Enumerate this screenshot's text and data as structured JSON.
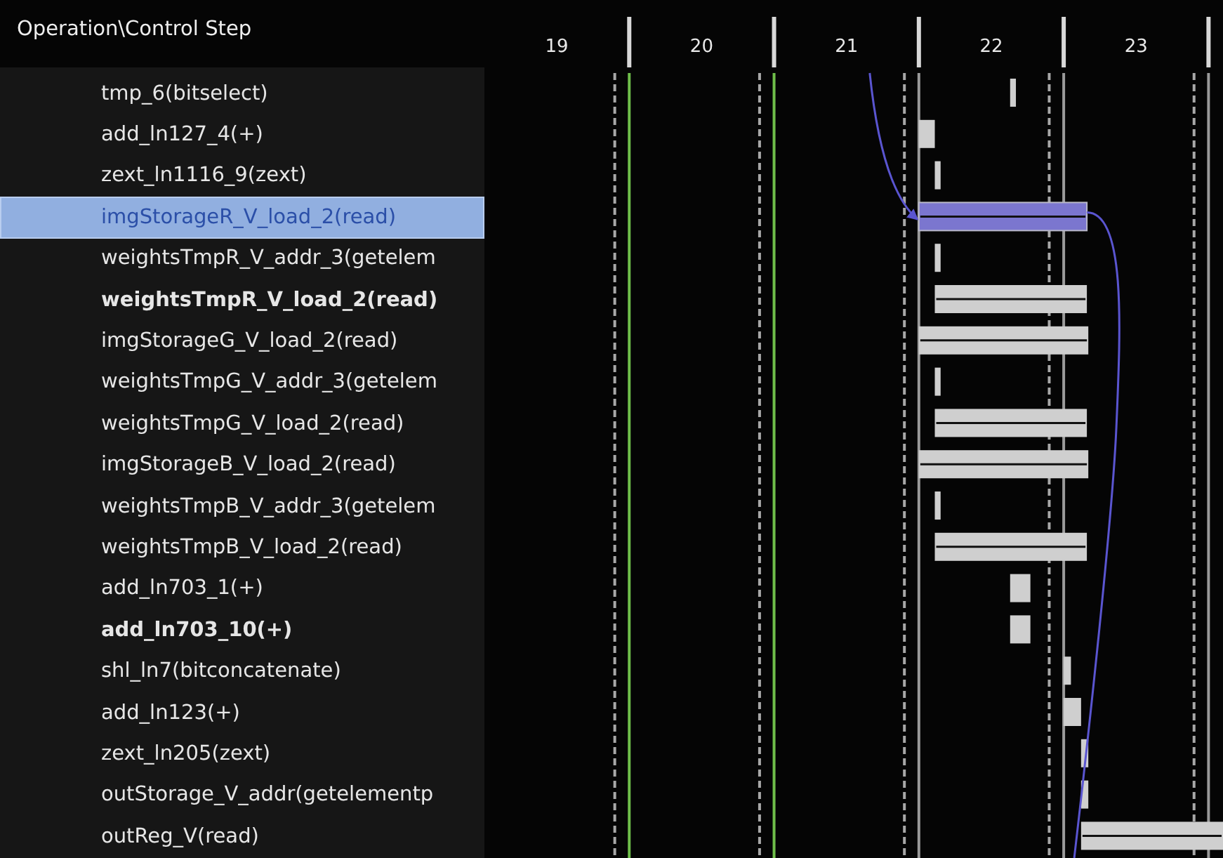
{
  "header": {
    "title": "Operation\\Control Step"
  },
  "operations": [
    {
      "label": "tmp_6(bitselect)",
      "selected": false,
      "bold": false
    },
    {
      "label": "add_ln127_4(+)",
      "selected": false,
      "bold": false
    },
    {
      "label": "zext_ln1116_9(zext)",
      "selected": false,
      "bold": false
    },
    {
      "label": "imgStorageR_V_load_2(read)",
      "selected": true,
      "bold": false
    },
    {
      "label": "weightsTmpR_V_addr_3(getelem",
      "selected": false,
      "bold": false
    },
    {
      "label": "weightsTmpR_V_load_2(read)",
      "selected": false,
      "bold": true
    },
    {
      "label": "imgStorageG_V_load_2(read)",
      "selected": false,
      "bold": false
    },
    {
      "label": "weightsTmpG_V_addr_3(getelem",
      "selected": false,
      "bold": false
    },
    {
      "label": "weightsTmpG_V_load_2(read)",
      "selected": false,
      "bold": false
    },
    {
      "label": "imgStorageB_V_load_2(read)",
      "selected": false,
      "bold": false
    },
    {
      "label": "weightsTmpB_V_addr_3(getelem",
      "selected": false,
      "bold": false
    },
    {
      "label": "weightsTmpB_V_load_2(read)",
      "selected": false,
      "bold": false
    },
    {
      "label": "add_ln703_1(+)",
      "selected": false,
      "bold": false
    },
    {
      "label": "add_ln703_10(+)",
      "selected": false,
      "bold": true
    },
    {
      "label": "shl_ln7(bitconcatenate)",
      "selected": false,
      "bold": false
    },
    {
      "label": "add_ln123(+)",
      "selected": false,
      "bold": false
    },
    {
      "label": "zext_ln205(zext)",
      "selected": false,
      "bold": false
    },
    {
      "label": "outStorage_V_addr(getelementp",
      "selected": false,
      "bold": false
    },
    {
      "label": "outReg_V(read)",
      "selected": false,
      "bold": false
    }
  ],
  "schedule": {
    "steps": [
      "19",
      "20",
      "21",
      "22",
      "23"
    ]
  }
}
